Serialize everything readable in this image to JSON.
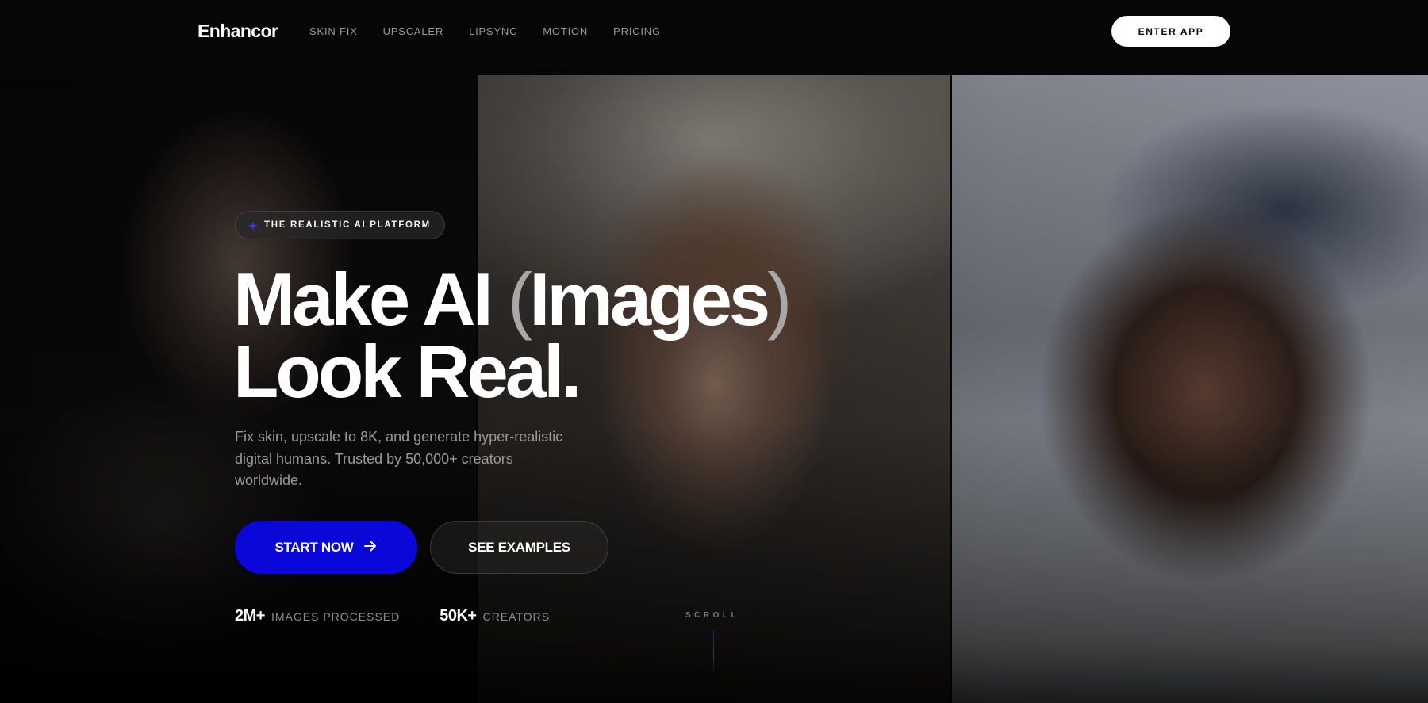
{
  "nav": {
    "logo": "Enhancor",
    "links": [
      "SKIN FIX",
      "UPSCALER",
      "LIPSYNC",
      "MOTION",
      "PRICING"
    ],
    "cta": "ENTER APP"
  },
  "hero": {
    "badge": "THE REALISTIC AI PLATFORM",
    "headline": {
      "line1_pre": "Make AI ",
      "paren_open": "(",
      "paren_word": "Images",
      "paren_close": ")",
      "line2": "Look Real."
    },
    "subtext": "Fix skin, upscale to 8K, and generate hyper-realistic digital humans. Trusted by 50,000+ creators worldwide.",
    "primary_button": "START NOW",
    "secondary_button": "SEE EXAMPLES",
    "stats": [
      {
        "value": "2M+",
        "label": "IMAGES PROCESSED"
      },
      {
        "value": "50K+",
        "label": "CREATORS"
      }
    ],
    "scroll_label": "SCROLL"
  },
  "colors": {
    "accent": "#0a07d8",
    "background": "#060606"
  }
}
